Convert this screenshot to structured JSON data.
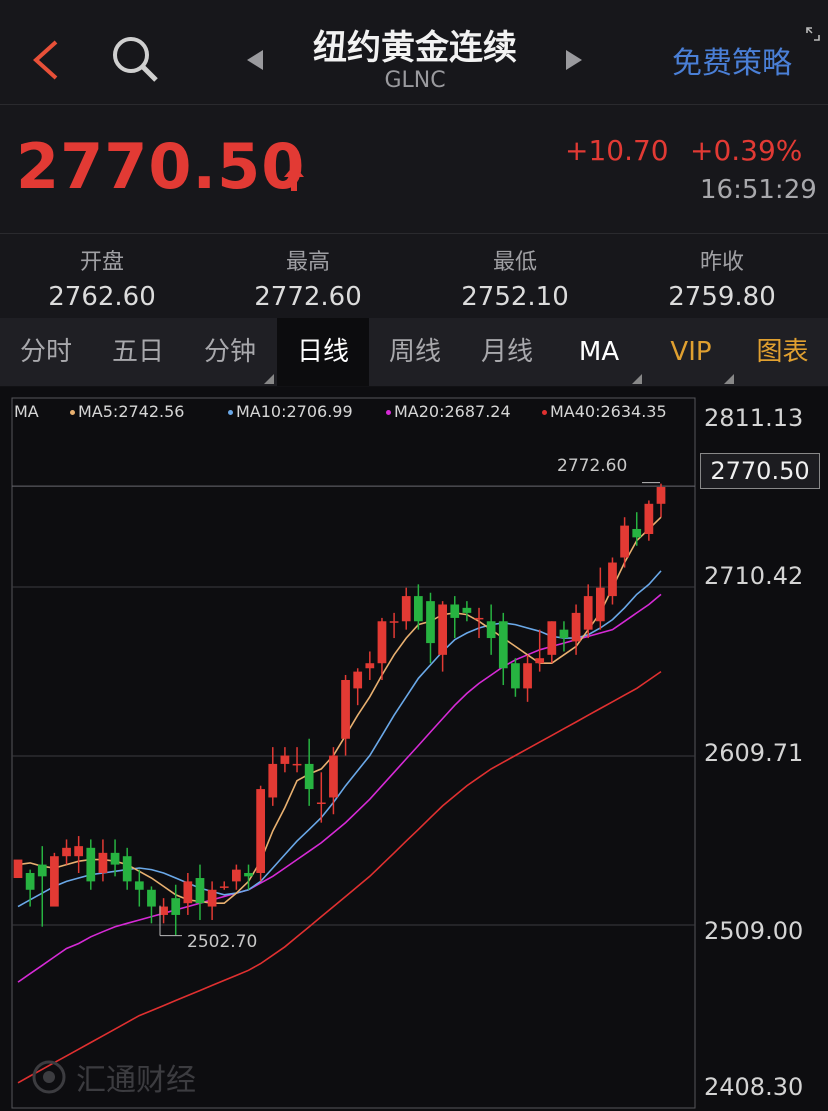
{
  "header": {
    "title": "纽约黄金连续",
    "subtitle": "GLNC",
    "strategy_label": "免费策略"
  },
  "quote": {
    "price": "2770.50",
    "change": "+10.70",
    "change_pct": "+0.39%",
    "time": "16:51:29",
    "color": "#e23a34"
  },
  "stats": [
    {
      "label": "开盘",
      "value": "2762.60"
    },
    {
      "label": "最高",
      "value": "2772.60"
    },
    {
      "label": "最低",
      "value": "2752.10"
    },
    {
      "label": "昨收",
      "value": "2759.80"
    }
  ],
  "tabs": [
    {
      "label": "分时"
    },
    {
      "label": "五日"
    },
    {
      "label": "分钟"
    },
    {
      "label": "日线",
      "active": true
    },
    {
      "label": "周线"
    },
    {
      "label": "月线"
    },
    {
      "label": "MA"
    },
    {
      "label": "VIP",
      "color": "#e0a030"
    },
    {
      "label": "图表",
      "color": "#e0a030"
    }
  ],
  "legend": {
    "ma": "MA",
    "ma5": "MA5:2742.56",
    "ma10": "MA10:2706.99",
    "ma20": "MA20:2687.24",
    "ma40": "MA40:2634.35"
  },
  "watermark": "汇通财经",
  "chart_data": {
    "type": "candlestick",
    "y_ticks": [
      "2811.13",
      "2710.42",
      "2609.71",
      "2509.00",
      "2408.30"
    ],
    "ylim": [
      2408.3,
      2811.13
    ],
    "current_price": "2770.50",
    "annotations": {
      "high": "2772.60",
      "low": "2502.70"
    },
    "colors": {
      "up": "#e23a34",
      "down": "#27b341",
      "ma5": "#e8b070",
      "ma10": "#6aa8e8",
      "ma20": "#d62ad6",
      "ma40": "#e03030"
    },
    "candles": [
      [
        2537,
        2548,
        2540,
        2545
      ],
      [
        2540,
        2530,
        2520,
        2542
      ],
      [
        2545,
        2538,
        2508,
        2556
      ],
      [
        2520,
        2550,
        2522,
        2552
      ],
      [
        2550,
        2555,
        2545,
        2560
      ],
      [
        2550,
        2556,
        2540,
        2562
      ],
      [
        2555,
        2535,
        2530,
        2560
      ],
      [
        2540,
        2552,
        2535,
        2560
      ],
      [
        2552,
        2545,
        2538,
        2560
      ],
      [
        2550,
        2535,
        2530,
        2555
      ],
      [
        2535,
        2530,
        2520,
        2542
      ],
      [
        2530,
        2520,
        2510,
        2532
      ],
      [
        2515,
        2520,
        2510,
        2525
      ],
      [
        2525,
        2515,
        2503,
        2533
      ],
      [
        2522,
        2535,
        2515,
        2540
      ],
      [
        2537,
        2522,
        2512,
        2545
      ],
      [
        2520,
        2530,
        2512,
        2535
      ],
      [
        2532,
        2532,
        2530,
        2535
      ],
      [
        2535,
        2542,
        2530,
        2545
      ],
      [
        2540,
        2538,
        2530,
        2545
      ],
      [
        2540,
        2590,
        2535,
        2592
      ],
      [
        2585,
        2605,
        2580,
        2615
      ],
      [
        2605,
        2610,
        2600,
        2615
      ],
      [
        2605,
        2605,
        2600,
        2615
      ],
      [
        2605,
        2590,
        2580,
        2620
      ],
      [
        2582,
        2582,
        2570,
        2600
      ],
      [
        2585,
        2610,
        2575,
        2615
      ],
      [
        2620,
        2655,
        2610,
        2658
      ],
      [
        2650,
        2660,
        2640,
        2662
      ],
      [
        2662,
        2665,
        2655,
        2672
      ],
      [
        2665,
        2690,
        2655,
        2692
      ],
      [
        2690,
        2690,
        2680,
        2695
      ],
      [
        2690,
        2705,
        2685,
        2710
      ],
      [
        2705,
        2690,
        2685,
        2712
      ],
      [
        2702,
        2677,
        2665,
        2707
      ],
      [
        2670,
        2700,
        2660,
        2702
      ],
      [
        2700,
        2692,
        2680,
        2705
      ],
      [
        2698,
        2695,
        2690,
        2702
      ],
      [
        2692,
        2692,
        2680,
        2698
      ],
      [
        2690,
        2680,
        2670,
        2700
      ],
      [
        2690,
        2662,
        2652,
        2695
      ],
      [
        2665,
        2650,
        2645,
        2668
      ],
      [
        2650,
        2665,
        2642,
        2670
      ],
      [
        2665,
        2668,
        2660,
        2685
      ],
      [
        2670,
        2690,
        2665,
        2690
      ],
      [
        2685,
        2680,
        2672,
        2690
      ],
      [
        2678,
        2695,
        2670,
        2700
      ],
      [
        2685,
        2705,
        2680,
        2712
      ],
      [
        2690,
        2710,
        2685,
        2722
      ],
      [
        2705,
        2725,
        2700,
        2728
      ],
      [
        2728,
        2747,
        2722,
        2752
      ],
      [
        2745,
        2740,
        2735,
        2755
      ],
      [
        2742,
        2760,
        2738,
        2762
      ],
      [
        2760,
        2770,
        2752,
        2772
      ]
    ],
    "ma5": [
      2545,
      2546,
      2544,
      2543,
      2545,
      2547,
      2548,
      2548,
      2547,
      2545,
      2541,
      2537,
      2532,
      2527,
      2524,
      2523,
      2522,
      2522,
      2528,
      2535,
      2547,
      2565,
      2579,
      2595,
      2599,
      2602,
      2610,
      2622,
      2634,
      2645,
      2658,
      2670,
      2680,
      2688,
      2690,
      2694,
      2695,
      2694,
      2690,
      2685,
      2680,
      2675,
      2670,
      2665,
      2665,
      2670,
      2675,
      2685,
      2695,
      2710,
      2725,
      2738,
      2745,
      2752
    ],
    "ma10": [
      2520,
      2524,
      2528,
      2532,
      2535,
      2537,
      2539,
      2540,
      2541,
      2542,
      2543,
      2542,
      2540,
      2537,
      2534,
      2531,
      2529,
      2527,
      2528,
      2530,
      2535,
      2543,
      2551,
      2559,
      2566,
      2573,
      2582,
      2592,
      2601,
      2610,
      2622,
      2634,
      2645,
      2656,
      2664,
      2672,
      2679,
      2683,
      2686,
      2688,
      2689,
      2688,
      2686,
      2684,
      2681,
      2680,
      2680,
      2682,
      2686,
      2691,
      2698,
      2706,
      2712,
      2720
    ],
    "ma20": [
      2475,
      2480,
      2485,
      2490,
      2495,
      2498,
      2502,
      2505,
      2508,
      2510,
      2512,
      2514,
      2516,
      2518,
      2520,
      2522,
      2524,
      2526,
      2528,
      2530,
      2534,
      2538,
      2543,
      2548,
      2553,
      2558,
      2564,
      2570,
      2577,
      2584,
      2592,
      2600,
      2608,
      2616,
      2624,
      2632,
      2640,
      2647,
      2653,
      2658,
      2663,
      2667,
      2670,
      2673,
      2675,
      2677,
      2679,
      2681,
      2683,
      2685,
      2690,
      2695,
      2700,
      2706
    ],
    "ma40": [
      2415,
      2419,
      2423,
      2427,
      2431,
      2435,
      2439,
      2443,
      2447,
      2451,
      2455,
      2458,
      2461,
      2464,
      2467,
      2470,
      2473,
      2476,
      2479,
      2482,
      2486,
      2491,
      2496,
      2502,
      2508,
      2514,
      2520,
      2526,
      2532,
      2538,
      2545,
      2552,
      2559,
      2566,
      2573,
      2580,
      2586,
      2592,
      2597,
      2602,
      2606,
      2610,
      2614,
      2618,
      2622,
      2626,
      2630,
      2634,
      2638,
      2642,
      2646,
      2650,
      2655,
      2660
    ]
  }
}
